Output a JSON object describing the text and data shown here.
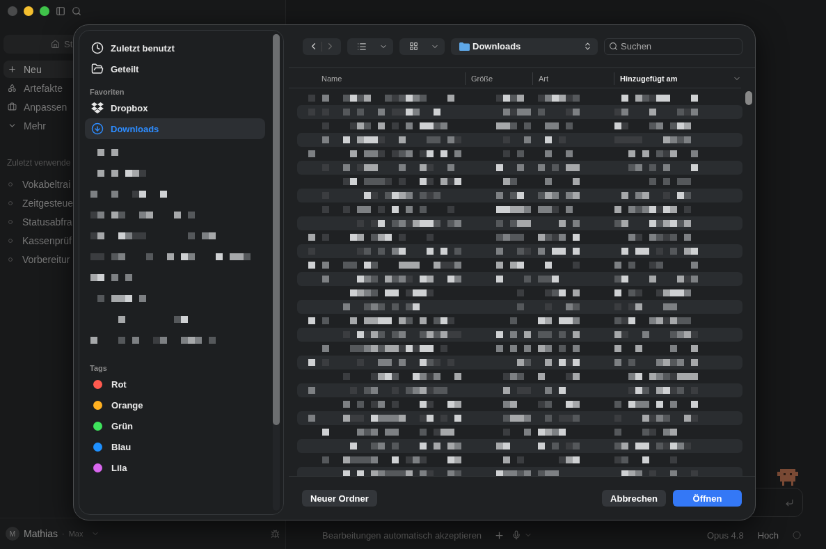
{
  "app": {
    "sidebar": {
      "top_button": "St",
      "nav": [
        {
          "label": "Neu",
          "selected": true
        },
        {
          "label": "Artefakte",
          "selected": false
        },
        {
          "label": "Anpassen",
          "selected": false
        },
        {
          "label": "Mehr",
          "selected": false
        }
      ],
      "recent_title": "Zuletzt verwende",
      "recent": [
        "Vokabeltrai",
        "Zeitgesteue",
        "Statusabfra",
        "Kassenprüf",
        "Vorbereitur"
      ],
      "user": {
        "initial": "M",
        "name": "Mathias",
        "separator": "·",
        "plan": "Max"
      }
    },
    "composer": {
      "auto_accept": "Bearbeitungen automatisch akzeptieren",
      "model": "Opus 4.8",
      "effort": "Hoch"
    }
  },
  "dialog": {
    "places": [
      {
        "label": "Zuletzt benutzt",
        "selected": false
      },
      {
        "label": "Geteilt",
        "selected": false
      }
    ],
    "favorites_title": "Favoriten",
    "favorites": [
      {
        "label": "Dropbox",
        "selected": false
      },
      {
        "label": "Downloads",
        "selected": true
      }
    ],
    "tags_title": "Tags",
    "tags": [
      {
        "label": "Rot",
        "color": "#ff5a4f"
      },
      {
        "label": "Orange",
        "color": "#ffb020"
      },
      {
        "label": "Grün",
        "color": "#3ee35c"
      },
      {
        "label": "Blau",
        "color": "#1e90ff"
      },
      {
        "label": "Lila",
        "color": "#d866ee"
      }
    ],
    "location": "Downloads",
    "search": {
      "placeholder": "Suchen"
    },
    "columns": [
      {
        "label": "Name",
        "selected": false
      },
      {
        "label": "Größe",
        "selected": false
      },
      {
        "label": "Art",
        "selected": false
      },
      {
        "label": "Hinzugefügt am",
        "selected": true
      }
    ],
    "buttons": {
      "new_folder": "Neuer Ordner",
      "cancel": "Abbrechen",
      "open": "Öffnen"
    }
  }
}
